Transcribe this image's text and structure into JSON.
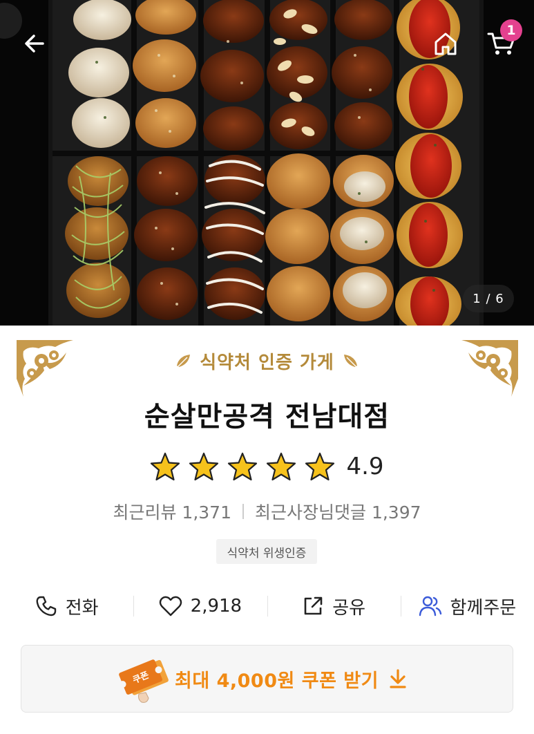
{
  "hero": {
    "page_indicator": "1 / 6",
    "cart_count": "1"
  },
  "store": {
    "certification_label": "식약처 인증 가게",
    "name": "순살만공격 전남대점",
    "rating": "4.9",
    "rating_stars": 5,
    "recent_reviews": "최근리뷰 1,371",
    "owner_replies": "최근사장님댓글 1,397",
    "hygiene_badge": "식약처 위생인증"
  },
  "actions": [
    {
      "label": "전화",
      "icon": "phone-icon"
    },
    {
      "label": "2,918",
      "icon": "heart-icon"
    },
    {
      "label": "공유",
      "icon": "share-icon"
    },
    {
      "label": "함께주문",
      "icon": "group-order-icon"
    }
  ],
  "coupon": {
    "ticket_label": "쿠폰",
    "text": "최대 4,000원 쿠폰 받기",
    "icon": "download-arrow-icon"
  },
  "colors": {
    "gold": "#b48a3a",
    "badge_pink": "#e4418f",
    "coupon_orange": "#f08a14",
    "star_yellow": "#f6c21c",
    "group_icon_blue": "#3b5bd9"
  }
}
